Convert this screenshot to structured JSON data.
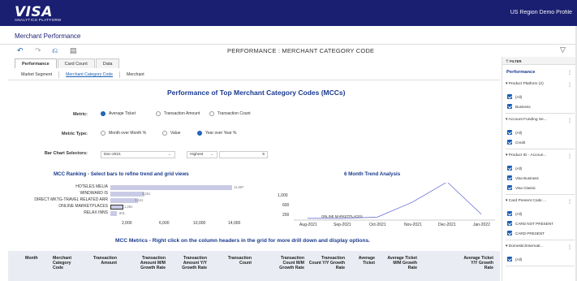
{
  "header": {
    "logo": "VISA",
    "logo_sub": "ANALYTICS PLATFORM",
    "region": "US Region Demo Profile"
  },
  "page_title": "Merchant Performance",
  "toolbar": {
    "title": "PERFORMANCE : MERCHANT CATEGORY CODE"
  },
  "tabs": [
    "Performance",
    "Card Count",
    "Data"
  ],
  "subtabs": [
    "Market Segment",
    "Merchant Category Code",
    "Merchant"
  ],
  "main": {
    "heading": "Performance of Top Merchant Category Codes (MCCs)",
    "metric_label": "Metric:",
    "metric_options": [
      "Average Ticket",
      "Transaction Amount",
      "Transaction Count"
    ],
    "metric_selected": 0,
    "metric_type_label": "Metric Type:",
    "metric_type_options": [
      "Month over Month %",
      "Value",
      "Year over Year %"
    ],
    "metric_type_selected": 2,
    "bar_selectors_label": "Bar Chart Selectors:",
    "month_select": "Dec-2021",
    "rank_select": "Highest",
    "count_input": "5"
  },
  "ranking": {
    "title": "MCC Ranking - Select bars to refine trend and grid views",
    "categories": [
      "HOTELES  MELIA",
      "WINDWARD  IS",
      "DIRECT  MKTG-TRAVEL  RELATED  ARR",
      "ONLINE  MARKETPLACES",
      "RELAX  INNS"
    ],
    "values": [
      11697,
      3261,
      2641,
      1281,
      601
    ],
    "value_labels": [
      "11,697",
      "3,261",
      "2,641",
      "1,281",
      "601"
    ],
    "xticks": [
      "2,000",
      "6,000",
      "10,000",
      "14,000"
    ]
  },
  "trend": {
    "title": "6 Month Trend Analysis",
    "yticks": [
      "1,000",
      "600",
      "200"
    ],
    "xticks": [
      "Aug-2021",
      "Sep-2021",
      "Oct-2021",
      "Nov-2021",
      "Dec-2021",
      "Jan-2022"
    ],
    "series_label": "ONLINE  MARKETPLACES"
  },
  "chart_data": [
    {
      "type": "bar",
      "title": "MCC Ranking - Select bars to refine trend and grid views",
      "categories": [
        "HOTELES MELIA",
        "WINDWARD IS",
        "DIRECT MKTG-TRAVEL RELATED ARR",
        "ONLINE MARKETPLACES",
        "RELAX INNS"
      ],
      "values": [
        11697,
        3261,
        2641,
        1281,
        601
      ],
      "xlim": [
        0,
        16000
      ]
    },
    {
      "type": "line",
      "title": "6 Month Trend Analysis",
      "x": [
        "Aug-2021",
        "Sep-2021",
        "Oct-2021",
        "Nov-2021",
        "Dec-2021",
        "Jan-2022"
      ],
      "series": [
        {
          "name": "ONLINE MARKETPLACES",
          "values": [
            60,
            60,
            100,
            600,
            1281,
            200
          ]
        }
      ],
      "ylim": [
        0,
        1200
      ]
    }
  ],
  "grid": {
    "title": "MCC Metrics - Right click on the column headers in the grid for more drill down and display options.",
    "columns": [
      "Month",
      "Merchant Category Code",
      "Transaction Amount",
      "Transaction Amount M/M Growth Rate",
      "Transaction Amount Y/Y Growth Rate",
      "Transaction Count",
      "Transaction Count M/M Growth Rate",
      "Transaction Count Y/Y Growth Rate",
      "Average Ticket",
      "Average Ticket M/M Growth Rate",
      "Average Ticket Y/Y Growth Rate"
    ]
  },
  "sidebar": {
    "filter_label": "FILTER",
    "title": "Performance",
    "groups": [
      {
        "label": "Product Platform (2)",
        "items": [
          "(All)",
          "Business"
        ]
      },
      {
        "label": "Account Funding Se...",
        "items": [
          "(All)",
          "Credit"
        ]
      },
      {
        "label": "Product ID - Accoun...",
        "items": [
          "(All)",
          "Visa Business",
          "Visa Classic"
        ]
      },
      {
        "label": "Card Present Code ...",
        "items": [
          "(All)",
          "CARD NOT PRESENT",
          "CARD PRESENT"
        ]
      },
      {
        "label": "Domestic/Internati...",
        "items": [
          "(All)"
        ]
      }
    ]
  }
}
